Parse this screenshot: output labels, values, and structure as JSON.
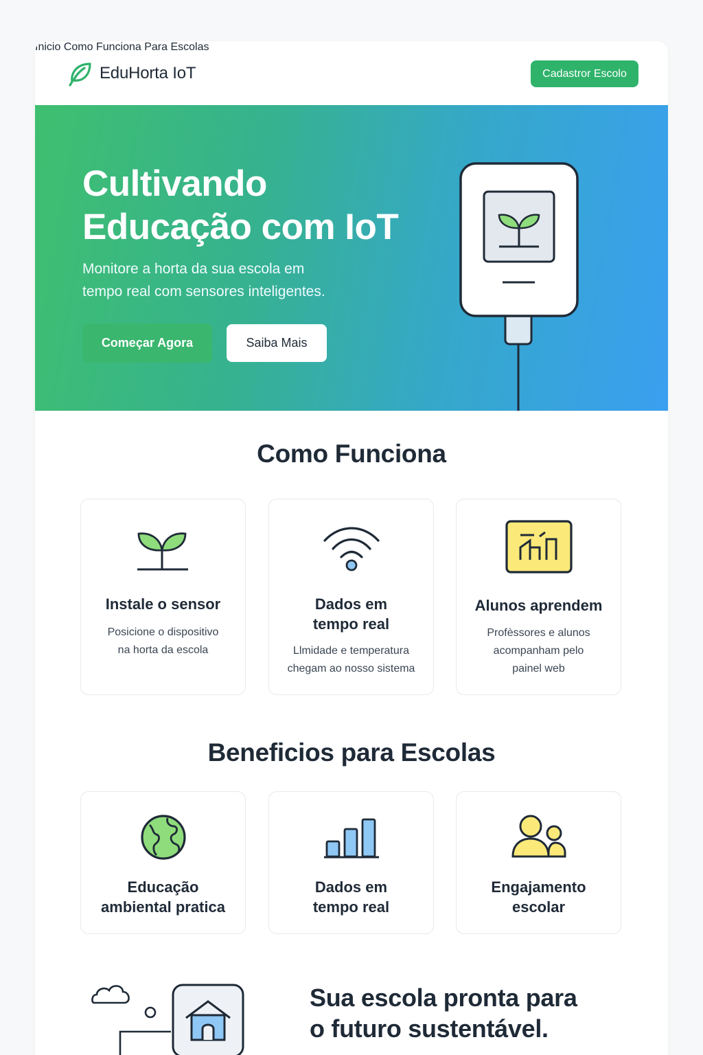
{
  "header": {
    "brand": "EduHorta IoT",
    "nav": [
      "Inicio",
      "Como Funciona",
      "Para Escolas"
    ],
    "cta": "Cadastror Escolo"
  },
  "hero": {
    "title_line1": "Cultivando",
    "title_line2": "Educação com IoT",
    "subtitle_line1": "Monitore a horta da sua escola em",
    "subtitle_line2": "tempo real com sensores inteligentes.",
    "primary_button": "Começar Agora",
    "secondary_button": "Saiba Mais"
  },
  "how": {
    "title": "Como Funciona",
    "cards": [
      {
        "icon": "sprout-icon",
        "title": "Instale o sensor",
        "desc_line1": "Posicione o dispositivo",
        "desc_line2": "na horta da escola"
      },
      {
        "icon": "wifi-icon",
        "title_line1": "Dados em",
        "title_line2": "tempo real",
        "desc_line1": "Llmidade e temperatura",
        "desc_line2": "chegam ao nosso sistema"
      },
      {
        "icon": "dashboard-chart-icon",
        "title": "Alunos aprendem",
        "desc_line1": "Profèssores e alunos",
        "desc_line2": "acompanham pelo",
        "desc_line3": "painel web"
      }
    ]
  },
  "benefits": {
    "title": "Beneficios para Escolas",
    "cards": [
      {
        "icon": "globe-icon",
        "title_line1": "Educação",
        "title_line2": "ambiental pratica"
      },
      {
        "icon": "bar-chart-icon",
        "title_line1": "Dados em",
        "title_line2": "tempo real"
      },
      {
        "icon": "users-icon",
        "title_line1": "Engajamento",
        "title_line2": "escolar"
      }
    ]
  },
  "closing": {
    "title_line1": "Sua escola pronta para",
    "title_line2": "o futuro sustentável."
  },
  "colors": {
    "brand_green": "#2fb36b",
    "hero_gradient_start": "#3fbf6f",
    "hero_gradient_end": "#3a9ff0",
    "text_dark": "#1f2a37",
    "icon_green": "#8fdc7c",
    "icon_yellow": "#fbe97a",
    "icon_blue": "#8fc7f5"
  }
}
